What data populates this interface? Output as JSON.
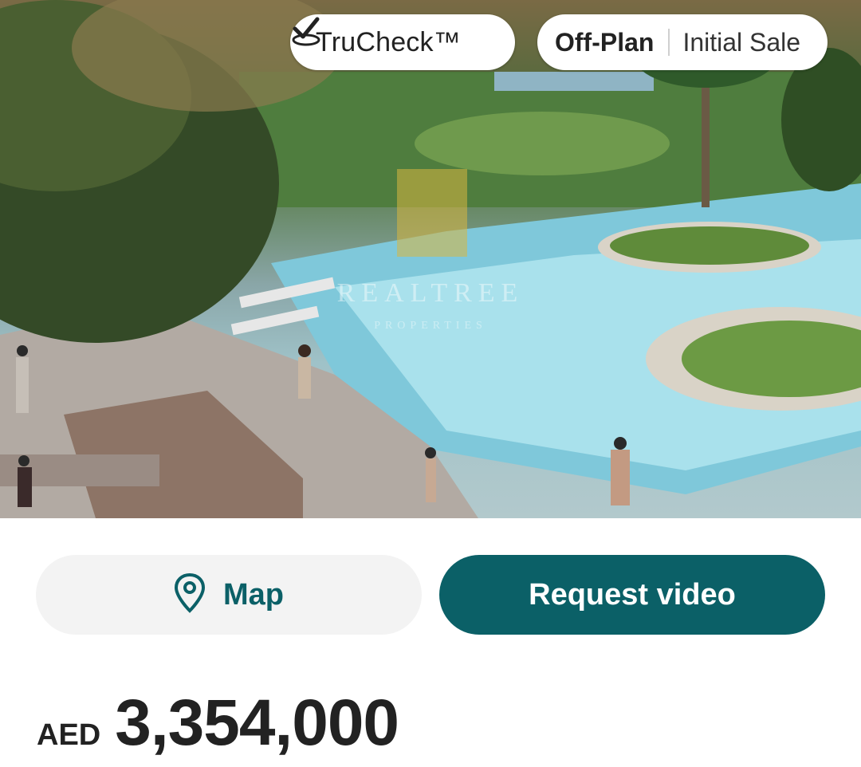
{
  "badges": {
    "trucheck_label": "TruCheck™",
    "status_primary": "Off-Plan",
    "status_secondary": "Initial Sale"
  },
  "actions": {
    "map_label": "Map",
    "video_label": "Request video"
  },
  "price": {
    "currency": "AED",
    "amount": "3,354,000"
  },
  "watermark": {
    "brand": "REALTREE",
    "sub": "PROPERTIES"
  },
  "colors": {
    "accent": "#0b6067",
    "map_button_bg": "#f3f3f3",
    "text_dark": "#222222"
  },
  "icons": {
    "trucheck": "check-badge-icon",
    "map": "map-pin-icon"
  }
}
